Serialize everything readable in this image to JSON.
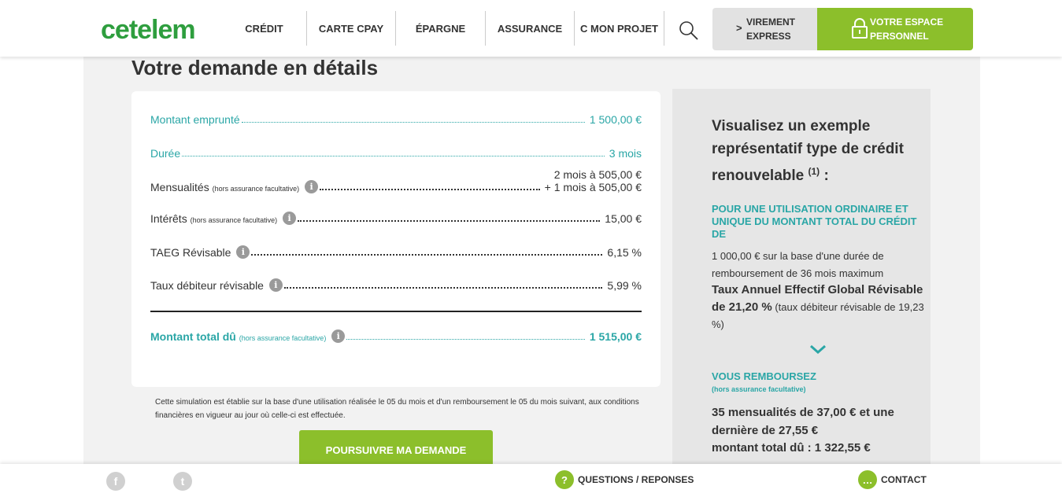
{
  "header": {
    "logo": "cetelem",
    "nav": [
      {
        "label": "CRÉDIT"
      },
      {
        "label": "CARTE CPAY"
      },
      {
        "label": "ÉPARGNE"
      },
      {
        "label": "ASSURANCE"
      },
      {
        "label": "C MON PROJET"
      }
    ],
    "virement_chevron": ">",
    "virement_label": "VIREMENT EXPRESS",
    "espace_label": "VOTRE ESPACE PERSONNEL"
  },
  "main": {
    "title": "Votre demande en détails",
    "rows": {
      "montant": {
        "label": "Montant emprunté",
        "value": "1 500,00 €"
      },
      "duree": {
        "label": "Durée",
        "value": "3 mois"
      },
      "mensualites": {
        "label": "Mensualités",
        "note": "(hors assurance facultative)",
        "value_line1": "2 mois à 505,00 €",
        "value_line2": "+ 1 mois à 505,00 €"
      },
      "interets": {
        "label": "Intérêts",
        "note": "(hors assurance facultative)",
        "value": "15,00 €"
      },
      "taeg": {
        "label": "TAEG Révisable",
        "value": "6,15 %"
      },
      "taux": {
        "label": "Taux débiteur révisable",
        "value": "5,99 %"
      },
      "total": {
        "label": "Montant total dû",
        "note": "(hors assurance facultative)",
        "value": "1 515,00 €"
      }
    },
    "info_glyph": "i",
    "disclaimer": "Cette simulation est établie sur la base d'une utilisation réalisée le 05 du mois et d'un remboursement le 05 du mois suivant, aux conditions financières en vigueur au jour où celle-ci est effectuée.",
    "continue_label": "POURSUIVRE MA DEMANDE"
  },
  "side": {
    "title": "Visualisez un exemple représentatif type de crédit renouvelable",
    "title_sup": "(1)",
    "title_suffix": " :",
    "h1": "POUR UNE UTILISATION ORDINAIRE ET UNIQUE DU MONTANT TOTAL DU CRÉDIT DE",
    "p1": "1 000,00 € sur la base d'une durée de remboursement de 36 mois maximum",
    "p2_strong": "Taux Annuel Effectif Global Révisable de 21,20 %",
    "p2_rest": " (taux débiteur révisable de 19,23 %)",
    "h2": "VOUS REMBOURSEZ",
    "h2_note": "(hors assurance facultative)",
    "strong1": "35 mensualités de 37,00 € et une dernière de 27,55 €",
    "strong2": "montant total dû : 1 322,55 €"
  },
  "footer": {
    "facebook_glyph": "f",
    "twitter_glyph": "t",
    "questions_glyph": "?",
    "questions_label": "QUESTIONS / REPONSES",
    "contact_glyph": "…",
    "contact_label": "CONTACT"
  },
  "colors": {
    "brand_green": "#2e9e3e",
    "accent_lime": "#8cbf2b",
    "teal": "#2aa6a6"
  }
}
